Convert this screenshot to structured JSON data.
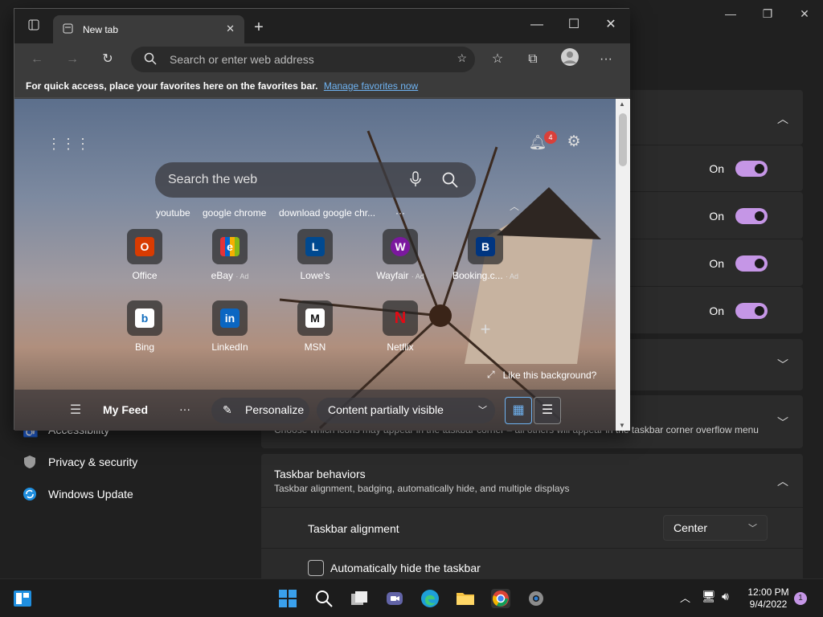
{
  "settings": {
    "toggles": [
      {
        "label": "On"
      },
      {
        "label": "On"
      },
      {
        "label": "On"
      },
      {
        "label": "On"
      }
    ],
    "overflow_desc": "Choose which icons may appear in the taskbar corner – all others will appear in the taskbar corner overflow menu",
    "behaviors_title": "Taskbar behaviors",
    "behaviors_desc": "Taskbar alignment, badging, automatically hide, and multiple displays",
    "alignment_label": "Taskbar alignment",
    "alignment_value": "Center",
    "autohide_label": "Automatically hide the taskbar",
    "nav": [
      {
        "label": "Accessibility"
      },
      {
        "label": "Privacy & security"
      },
      {
        "label": "Windows Update"
      }
    ],
    "accent": "#c596e6"
  },
  "browser": {
    "tab_title": "New tab",
    "address_placeholder": "Search or enter web address",
    "favbar_text": "For quick access, place your favorites here on the favorites bar.",
    "favbar_link": "Manage favorites now",
    "notif_count": "4",
    "search_placeholder": "Search the web",
    "suggestions": [
      "youtube",
      "google chrome",
      "download google chr...",
      "···"
    ],
    "tiles_row1": [
      {
        "label": "Office",
        "ad": "",
        "color": "#d83b01",
        "glyph": "O"
      },
      {
        "label": "eBay",
        "ad": "· Ad",
        "color": "#e53238",
        "glyph": "e"
      },
      {
        "label": "Lowe's",
        "ad": "",
        "color": "#004990",
        "glyph": "L"
      },
      {
        "label": "Wayfair",
        "ad": "· Ad",
        "color": "#7b189f",
        "glyph": "W"
      },
      {
        "label": "Booking.c...",
        "ad": "· Ad",
        "color": "#003580",
        "glyph": "B"
      }
    ],
    "tiles_row2": [
      {
        "label": "Bing",
        "ad": "",
        "color": "#0f6cbd",
        "glyph": "b"
      },
      {
        "label": "LinkedIn",
        "ad": "",
        "color": "#0a66c2",
        "glyph": "in"
      },
      {
        "label": "MSN",
        "ad": "",
        "color": "#111111",
        "glyph": "M"
      },
      {
        "label": "Netflix",
        "ad": "",
        "color": "#e50914",
        "glyph": "N"
      }
    ],
    "like_bg": "Like this background?",
    "feed_title": "My Feed",
    "feed_more": "···",
    "personalize": "Personalize",
    "content_visibility": "Content partially visible"
  },
  "taskbar": {
    "time": "12:00 PM",
    "date": "9/4/2022",
    "notif_badge": "1"
  }
}
